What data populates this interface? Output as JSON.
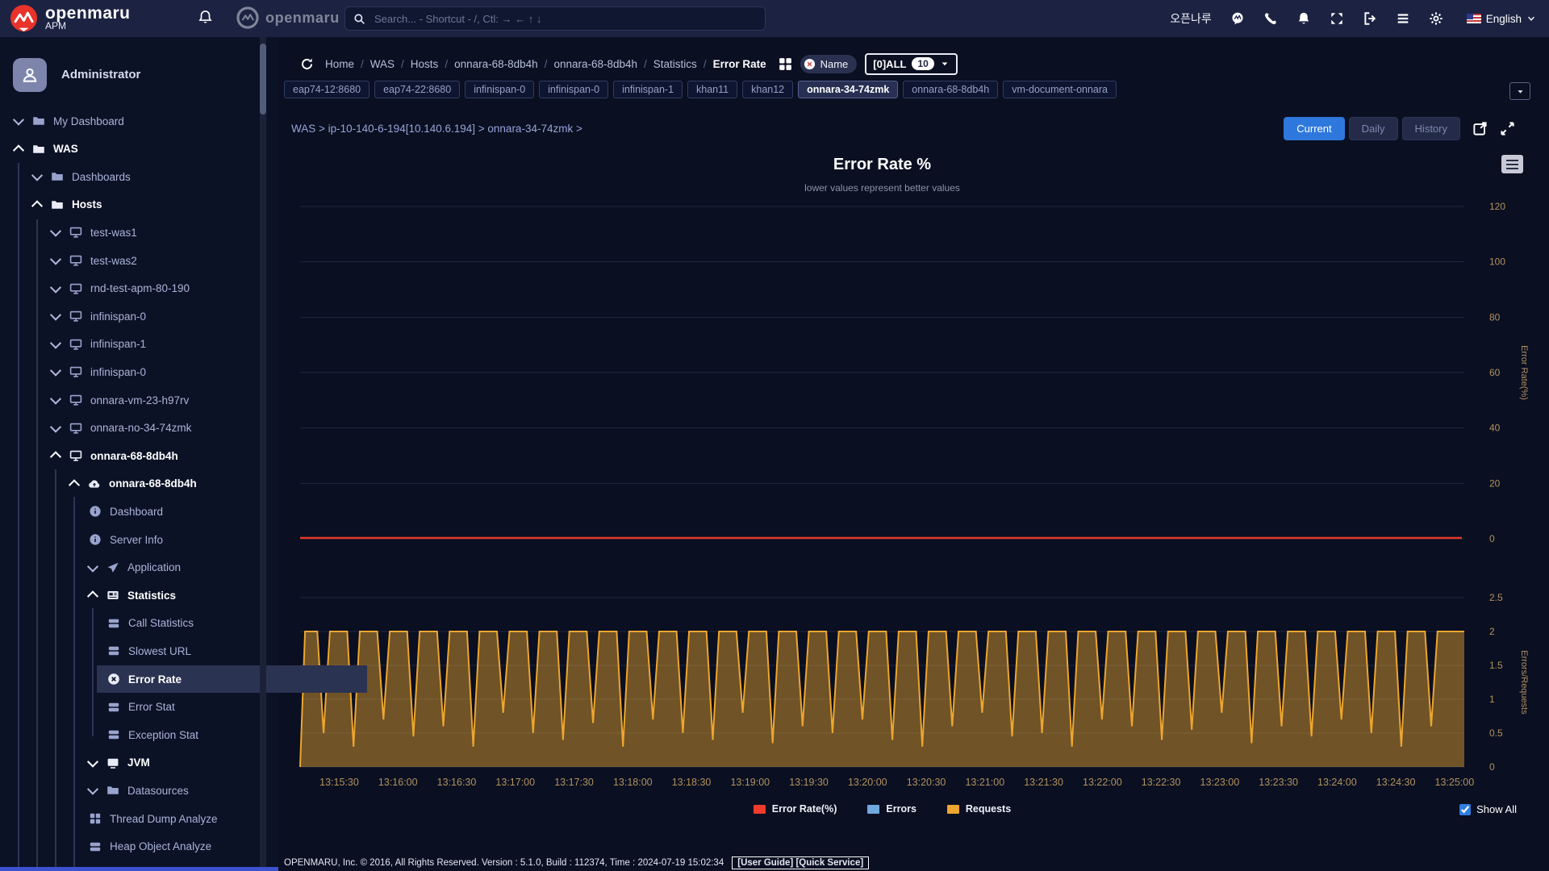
{
  "topbar": {
    "brand": "openmaru",
    "brand_sub": "APM",
    "brand2": "openmaru",
    "search_placeholder": "Search... - Shortcut - /, Ctl: → ← ↑ ↓",
    "user_name": "오픈나루",
    "right_icons": [
      "openmaru-chat-icon",
      "phone-icon",
      "bell-icon",
      "fullscreen-icon",
      "logout-icon",
      "menu-icon",
      "settings-icon"
    ],
    "language": "English"
  },
  "sidebar": {
    "user": "Administrator",
    "tree": [
      {
        "label": "My Dashboard",
        "depth": 0,
        "icon": "folder-icon",
        "chev": "down"
      },
      {
        "label": "WAS",
        "depth": 0,
        "icon": "folder-icon",
        "chev": "up",
        "bold": true
      },
      {
        "label": "Dashboards",
        "depth": 1,
        "icon": "folder-icon",
        "chev": "down"
      },
      {
        "label": "Hosts",
        "depth": 1,
        "icon": "folder-icon",
        "chev": "up",
        "bold": true
      },
      {
        "label": "test-was1",
        "depth": 2,
        "icon": "monitor-icon",
        "chev": "down"
      },
      {
        "label": "test-was2",
        "depth": 2,
        "icon": "monitor-icon",
        "chev": "down"
      },
      {
        "label": "rnd-test-apm-80-190",
        "depth": 2,
        "icon": "monitor-icon",
        "chev": "down"
      },
      {
        "label": "infinispan-0",
        "depth": 2,
        "icon": "monitor-icon",
        "chev": "down"
      },
      {
        "label": "infinispan-1",
        "depth": 2,
        "icon": "monitor-icon",
        "chev": "down"
      },
      {
        "label": "infinispan-0",
        "depth": 2,
        "icon": "monitor-icon",
        "chev": "down"
      },
      {
        "label": "onnara-vm-23-h97rv",
        "depth": 2,
        "icon": "monitor-icon",
        "chev": "down"
      },
      {
        "label": "onnara-no-34-74zmk",
        "depth": 2,
        "icon": "monitor-icon",
        "chev": "down"
      },
      {
        "label": "onnara-68-8db4h",
        "depth": 2,
        "icon": "monitor-icon",
        "chev": "up",
        "bold": true
      },
      {
        "label": "onnara-68-8db4h",
        "depth": 3,
        "icon": "cloud-icon",
        "chev": "up",
        "bold": true
      },
      {
        "label": "Dashboard",
        "depth": 4,
        "icon": "info-icon"
      },
      {
        "label": "Server Info",
        "depth": 4,
        "icon": "info-icon"
      },
      {
        "label": "Application",
        "depth": 4,
        "icon": "send-icon",
        "chev": "down"
      },
      {
        "label": "Statistics",
        "depth": 4,
        "icon": "stats-icon",
        "chev": "up",
        "bold": true
      },
      {
        "label": "Call Statistics",
        "depth": 5,
        "icon": "list-icon"
      },
      {
        "label": "Slowest URL",
        "depth": 5,
        "icon": "list-icon"
      },
      {
        "label": "Error Rate",
        "depth": 5,
        "icon": "error-icon",
        "selected": true,
        "bold": true
      },
      {
        "label": "Error Stat",
        "depth": 5,
        "icon": "list-icon"
      },
      {
        "label": "Exception Stat",
        "depth": 5,
        "icon": "list-icon"
      },
      {
        "label": "JVM",
        "depth": 4,
        "icon": "jvm-icon",
        "chev": "down",
        "bold": true
      },
      {
        "label": "Datasources",
        "depth": 4,
        "icon": "folder-icon",
        "chev": "down"
      },
      {
        "label": "Thread Dump Analyze",
        "depth": 4,
        "icon": "grid-icon"
      },
      {
        "label": "Heap Object Analyze",
        "depth": 4,
        "icon": "list-icon"
      }
    ]
  },
  "breadcrumb": {
    "items": [
      "Home",
      "WAS",
      "Hosts",
      "onnara-68-8db4h",
      "onnara-68-8db4h",
      "Statistics",
      "Error Rate"
    ],
    "name_filter": "Name",
    "all_dropdown": "[0]ALL",
    "all_count": "10"
  },
  "chips": {
    "items": [
      "eap74-12:8680",
      "eap74-22:8680",
      "infinispan-0",
      "infinispan-0",
      "infinispan-1",
      "khan11",
      "khan12",
      "onnara-34-74zmk",
      "onnara-68-8db4h",
      "vm-document-onnara"
    ],
    "selected": "onnara-34-74zmk"
  },
  "context_path": "WAS > ip-10-140-6-194[10.140.6.194] > onnara-34-74zmk >",
  "view_tabs": {
    "items": [
      "Current",
      "Daily",
      "History"
    ],
    "active": "Current"
  },
  "chart": {
    "title": "Error Rate %",
    "subtitle": "lower values represent better values",
    "legend": [
      {
        "label": "Error Rate(%)",
        "color": "#ee3b2c"
      },
      {
        "label": "Errors",
        "color": "#70a8e0"
      },
      {
        "label": "Requests",
        "color": "#eda62f"
      }
    ],
    "show_all_label": "Show All",
    "show_all_checked": true
  },
  "chart_data": {
    "type": "line",
    "x_ticks": [
      "13:15:30",
      "13:16:00",
      "13:16:30",
      "13:17:00",
      "13:17:30",
      "13:18:00",
      "13:18:30",
      "13:19:00",
      "13:19:30",
      "13:20:00",
      "13:20:30",
      "13:21:00",
      "13:21:30",
      "13:22:00",
      "13:22:30",
      "13:23:00",
      "13:23:30",
      "13:24:00",
      "13:24:30",
      "13:25:00"
    ],
    "grid": true,
    "top": {
      "ylabel": "Error Rate(%)",
      "ylim": [
        0,
        120
      ],
      "yticks": [
        0,
        20,
        40,
        60,
        80,
        100,
        120
      ],
      "series": [
        {
          "name": "Error Rate(%)",
          "color": "#e23a2a",
          "constant_value": 0
        }
      ]
    },
    "bottom": {
      "ylabel": "Errors/Requests",
      "ylim": [
        0,
        2.5
      ],
      "yticks": [
        0,
        0.5,
        1,
        1.5,
        2,
        2.5
      ],
      "series": [
        {
          "name": "Errors",
          "color": "#70a8e0",
          "constant_value": 0
        },
        {
          "name": "Requests",
          "color": "#eda62f",
          "fill": "rgba(237,166,47,0.45)",
          "plateau": 2,
          "first_dip_s": 12,
          "dip_interval_s": 15.3,
          "dip_half_width_s": 3.2,
          "duration_s": 595,
          "dip_minima": [
            0.5,
            0.3,
            0.7,
            0.45,
            0.6,
            0.3,
            0.8,
            0.5,
            0.4,
            0.65,
            0.3,
            0.7,
            0.5,
            0.4,
            0.8,
            0.35,
            0.6,
            0.5,
            0.7,
            0.4,
            0.3,
            0.6,
            0.8,
            0.45,
            0.5,
            0.3,
            0.7,
            0.6,
            0.4,
            0.55,
            0.8,
            0.35,
            0.6,
            0.45,
            0.7,
            0.5,
            0.3,
            0.6
          ]
        }
      ]
    },
    "axis_label_color": "#b3925f"
  },
  "footer": {
    "text": "OPENMARU, Inc. © 2016, All Rights Reserved.  Version : 5.1.0, Build : 112374, Time : 2024-07-19 15:02:34",
    "links": "[User Guide] [Quick Service]"
  }
}
